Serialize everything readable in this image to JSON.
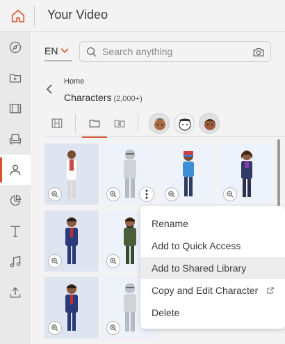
{
  "app": {
    "title": "Your Video"
  },
  "rail": {
    "items": [
      {
        "name": "rail-compass",
        "icon": "compass-icon"
      },
      {
        "name": "rail-media",
        "icon": "media-folder-icon"
      },
      {
        "name": "rail-scenes",
        "icon": "film-icon"
      },
      {
        "name": "rail-props",
        "icon": "armchair-icon"
      },
      {
        "name": "rail-characters",
        "icon": "person-icon",
        "active": true
      },
      {
        "name": "rail-charts",
        "icon": "pie-chart-icon"
      },
      {
        "name": "rail-text",
        "icon": "text-icon"
      },
      {
        "name": "rail-audio",
        "icon": "music-note-icon"
      },
      {
        "name": "rail-upload",
        "icon": "upload-icon"
      }
    ]
  },
  "toolbar": {
    "language": "EN",
    "search_placeholder": "Search anything"
  },
  "breadcrumb": {
    "home": "Home",
    "title": "Characters",
    "count": "(2,000+)"
  },
  "filters": {
    "active": "folder",
    "items": [
      "grid-view",
      "folder",
      "character-folder"
    ],
    "avatars": [
      "avatar-style-1",
      "avatar-style-2",
      "avatar-style-3"
    ]
  },
  "colors": {
    "accent": "#d9532c",
    "tile_bg": "#e7ecf6"
  },
  "menu": {
    "items": [
      {
        "label": "Rename"
      },
      {
        "label": "Add to Quick Access"
      },
      {
        "label": "Add to Shared Library",
        "hover": true
      },
      {
        "label": "Copy and Edit Character",
        "icon": "external-link-icon"
      },
      {
        "label": "Delete"
      }
    ]
  }
}
